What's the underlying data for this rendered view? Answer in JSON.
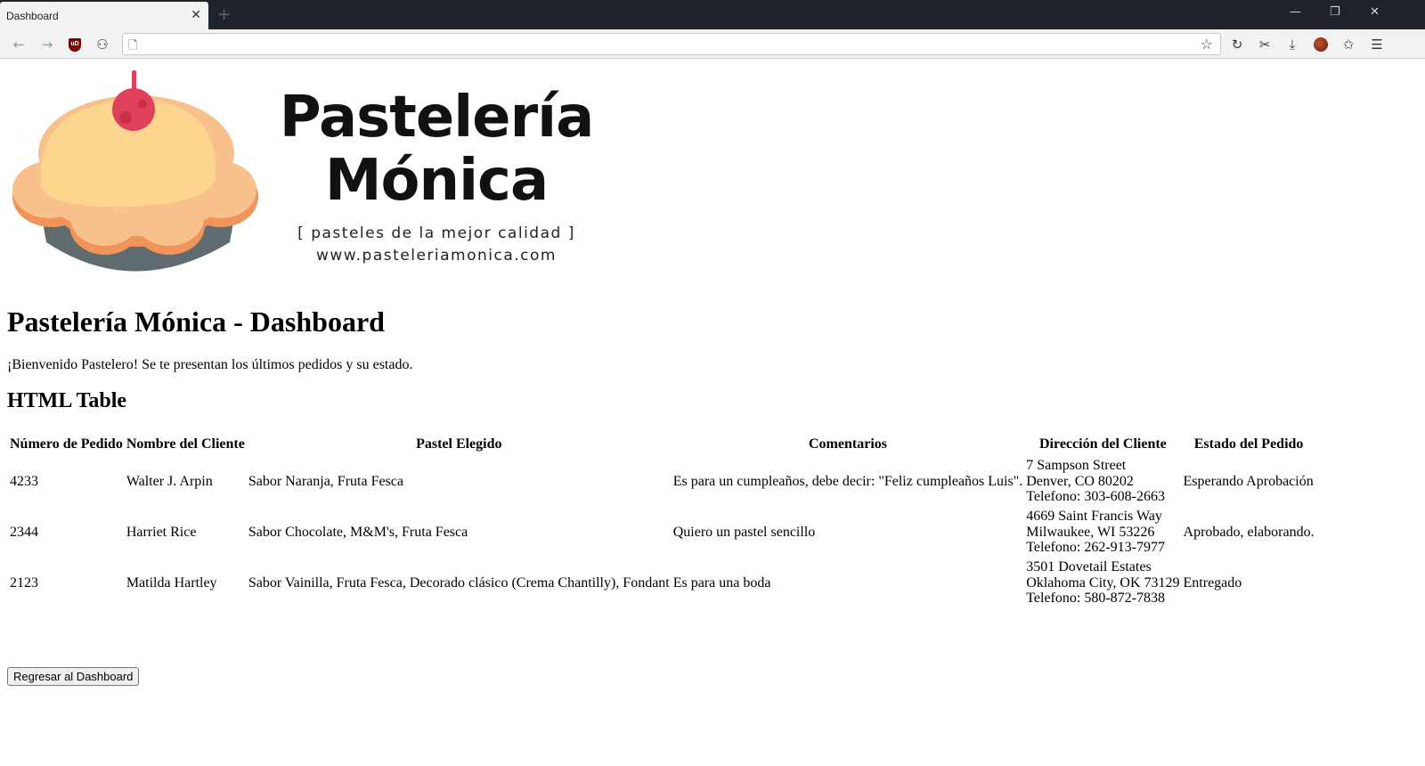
{
  "browser": {
    "tab_title": "Dashboard",
    "tab_close": "✕",
    "new_tab": "+",
    "window_controls": [
      "—",
      "❐",
      "✕"
    ],
    "ublock_badge": "uD"
  },
  "brand": {
    "name_line1": "Pastelería",
    "name_line2": "Mónica",
    "tagline": "[ pasteles de la mejor calidad ]",
    "url": "www.pasteleriamonica.com",
    "colors": {
      "crust": "#f8c08c",
      "cream": "#fcd68e",
      "cherry": "#e0405a",
      "pan": "#5f6b6f",
      "edge": "#f0945c"
    }
  },
  "page": {
    "title": "Pastelería Mónica - Dashboard",
    "welcome": "¡Bienvenido Pastelero! Se te presentan los últimos pedidos y su estado.",
    "table_heading": "HTML Table",
    "back_button": "Regresar al Dashboard"
  },
  "orders": {
    "headers": [
      "Número de Pedido",
      "Nombre del Cliente",
      "Pastel Elegido",
      "Comentarios",
      "Dirección del Cliente",
      "Estado del Pedido"
    ],
    "rows": [
      {
        "id": "4233",
        "name": "Walter J. Arpin",
        "cake": "Sabor Naranja, Fruta Fesca",
        "comment": "Es para un cumpleaños, debe decir: \"Feliz cumpleaños Luis\".",
        "addr1": "7 Sampson Street",
        "addr2": "Denver, CO 80202",
        "phone": "Telefono: 303-608-2663",
        "status": "Esperando Aprobación"
      },
      {
        "id": "2344",
        "name": "Harriet Rice",
        "cake": "Sabor Chocolate, M&M's, Fruta Fesca",
        "comment": "Quiero un pastel sencillo",
        "addr1": "4669 Saint Francis Way",
        "addr2": "Milwaukee, WI 53226",
        "phone": "Telefono: 262-913-7977",
        "status": "Aprobado, elaborando."
      },
      {
        "id": "2123",
        "name": "Matilda Hartley",
        "cake": "Sabor Vainilla, Fruta Fesca, Decorado clásico (Crema Chantilly), Fondant",
        "comment": "Es para una boda",
        "addr1": "3501 Dovetail Estates",
        "addr2": "Oklahoma City, OK 73129",
        "phone": "Telefono: 580-872-7838",
        "status": "Entregado"
      }
    ]
  }
}
